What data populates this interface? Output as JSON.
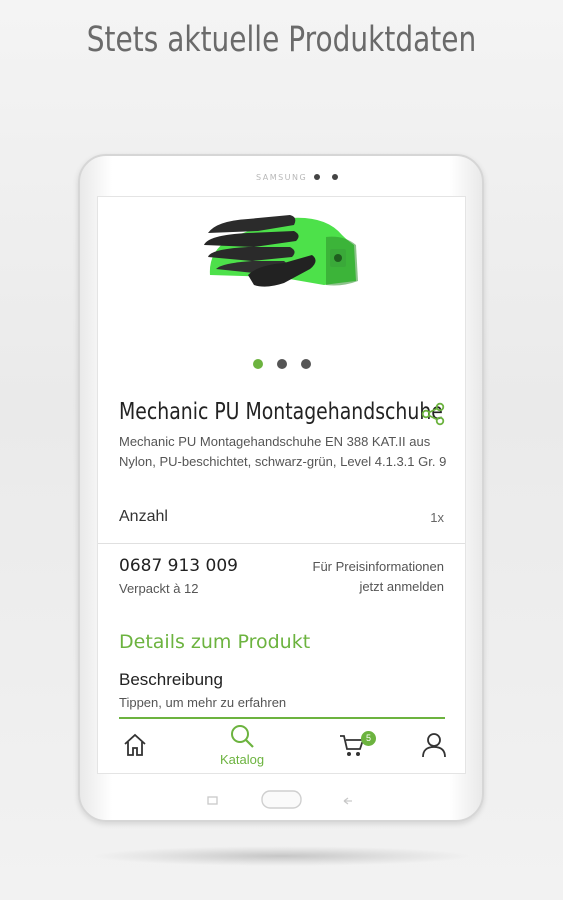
{
  "headline": "Stets aktuelle Produktdaten",
  "device": {
    "brand": "SAMSUNG"
  },
  "carousel": {
    "pages": 3,
    "active_page": 1
  },
  "product": {
    "title": "Mechanic PU Montagehandschuhe",
    "description": "Mechanic PU Montagehandschuhe EN 388 KAT.II aus Nylon, PU-beschichtet, schwarz-grün, Level 4.1.3.1 Gr. 9",
    "quantity_label": "Anzahl",
    "quantity_value": "1x",
    "article_number": "0687 913 009",
    "packaging": "Verpackt à 12",
    "price_info_line1": "Für Preisinformationen",
    "price_info_line2": "jetzt anmelden"
  },
  "details": {
    "heading": "Details zum Produkt",
    "section_title": "Beschreibung",
    "section_hint": "Tippen, um mehr zu erfahren"
  },
  "bottom_nav": {
    "items": [
      {
        "icon": "home-icon"
      },
      {
        "icon": "search-icon",
        "label": "Katalog",
        "active": true
      },
      {
        "icon": "cart-icon",
        "badge": "5"
      },
      {
        "icon": "user-icon"
      }
    ]
  },
  "colors": {
    "accent": "#6cb33f",
    "text": "#222222",
    "muted": "#555555"
  }
}
